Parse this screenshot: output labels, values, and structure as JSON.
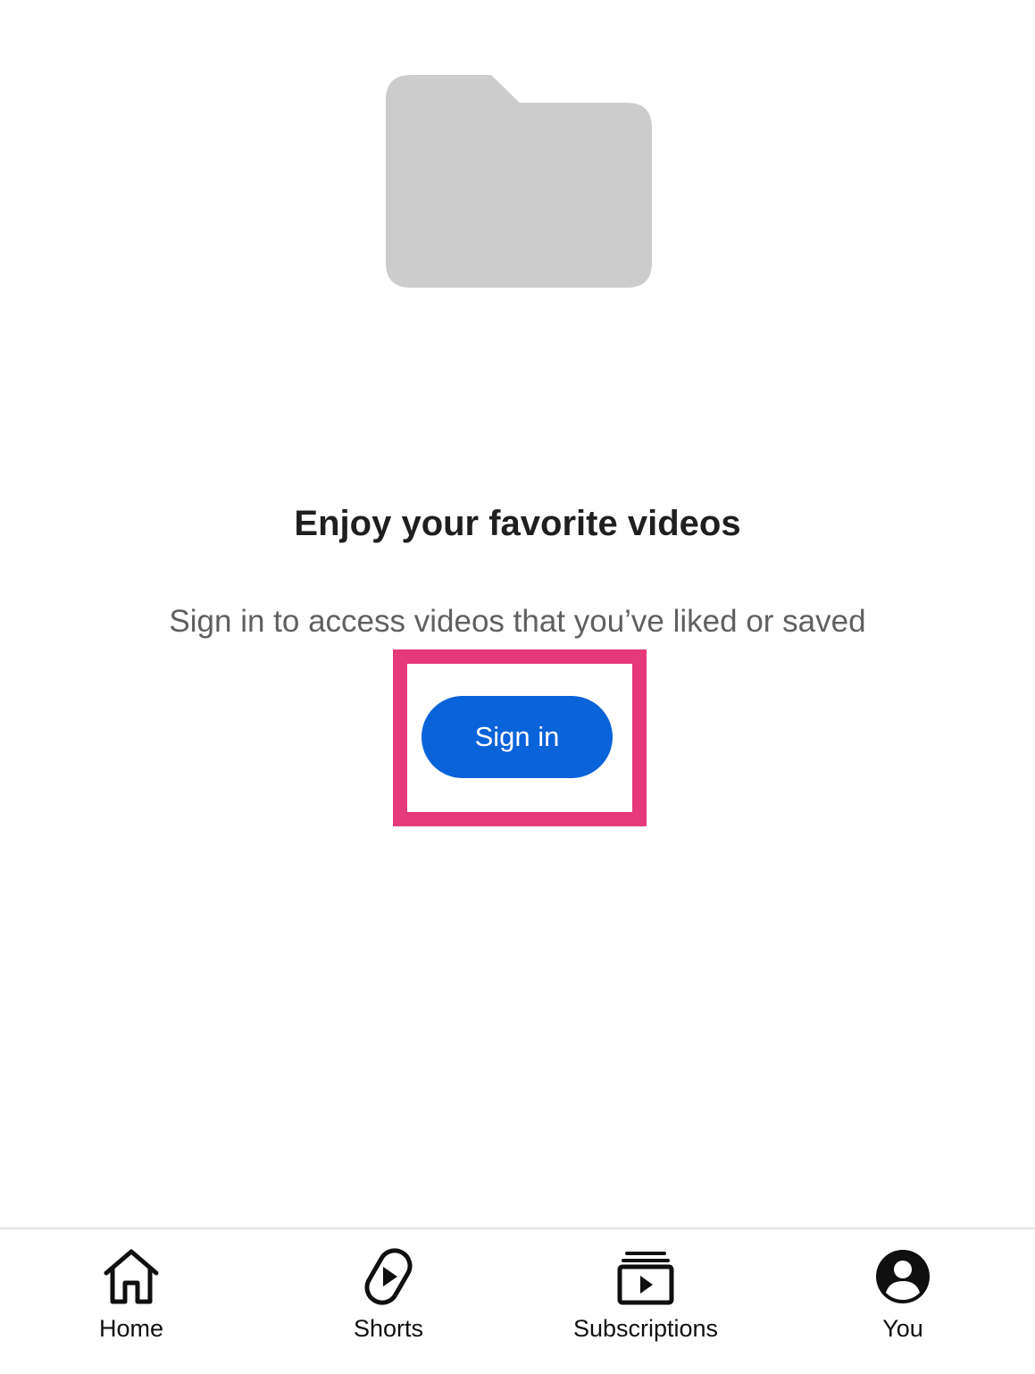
{
  "empty_state": {
    "title": "Enjoy your favorite videos",
    "subtitle": "Sign in to access videos that you’ve liked or saved",
    "button_label": "Sign in"
  },
  "bottom_nav": {
    "items": [
      {
        "label": "Home",
        "icon": "home-icon"
      },
      {
        "label": "Shorts",
        "icon": "shorts-icon"
      },
      {
        "label": "Subscriptions",
        "icon": "subscriptions-icon"
      },
      {
        "label": "You",
        "icon": "account-icon"
      }
    ]
  },
  "colors": {
    "button": "#0b63da",
    "highlight": "#e5397a",
    "folder": "#cccccc"
  }
}
